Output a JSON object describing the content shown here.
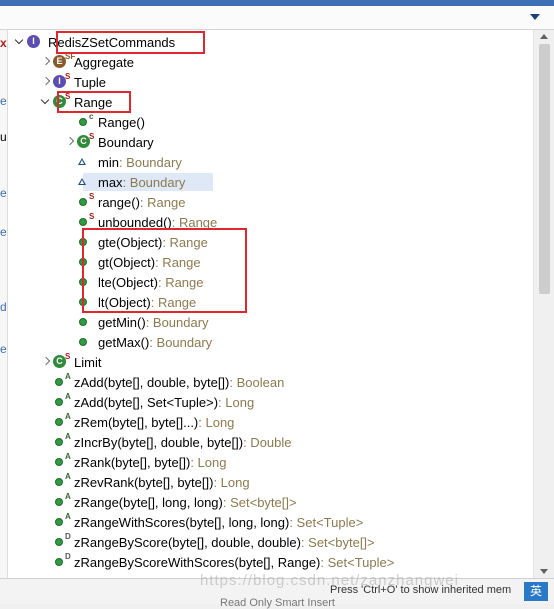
{
  "outline": {
    "root": {
      "label": "RedisZSetCommands",
      "icon": "interface-icon"
    },
    "items": [
      {
        "label": "Aggregate",
        "type": "",
        "indent": 1,
        "exp": "collapsed",
        "icon": "enum",
        "letter": "E",
        "mod": "SF",
        "modclass": "f"
      },
      {
        "label": "Tuple",
        "type": "",
        "indent": 1,
        "exp": "collapsed",
        "icon": "intf",
        "letter": "I",
        "mod": "S",
        "modclass": "s"
      },
      {
        "label": "Range",
        "type": "",
        "indent": 1,
        "exp": "expanded",
        "icon": "cls",
        "letter": "C",
        "mod": "S",
        "modclass": "s"
      },
      {
        "label": "Range()",
        "type": "",
        "indent": 2,
        "exp": "none",
        "icon": "dot",
        "mod": "c",
        "modclass": "c"
      },
      {
        "label": "Boundary",
        "type": "",
        "indent": 2,
        "exp": "collapsed",
        "icon": "cls",
        "letter": "C",
        "mod": "S",
        "modclass": "s"
      },
      {
        "label": "min",
        "type": " : Boundary",
        "indent": 2,
        "exp": "none",
        "icon": "tri",
        "mod": "",
        "modclass": ""
      },
      {
        "label": "max",
        "type": " : Boundary",
        "indent": 2,
        "exp": "none",
        "icon": "tri",
        "mod": "",
        "modclass": "",
        "selected": true
      },
      {
        "label": "range()",
        "type": " : Range",
        "indent": 2,
        "exp": "none",
        "icon": "dot",
        "mod": "S",
        "modclass": "s"
      },
      {
        "label": "unbounded()",
        "type": " : Range",
        "indent": 2,
        "exp": "none",
        "icon": "dot",
        "mod": "S",
        "modclass": "s"
      },
      {
        "label": "gte(Object)",
        "type": " : Range",
        "indent": 2,
        "exp": "none",
        "icon": "dot",
        "mod": "",
        "modclass": ""
      },
      {
        "label": "gt(Object)",
        "type": " : Range",
        "indent": 2,
        "exp": "none",
        "icon": "dot",
        "mod": "",
        "modclass": ""
      },
      {
        "label": "lte(Object)",
        "type": " : Range",
        "indent": 2,
        "exp": "none",
        "icon": "dot",
        "mod": "",
        "modclass": ""
      },
      {
        "label": "lt(Object)",
        "type": " : Range",
        "indent": 2,
        "exp": "none",
        "icon": "dot",
        "mod": "",
        "modclass": ""
      },
      {
        "label": "getMin()",
        "type": " : Boundary",
        "indent": 2,
        "exp": "none",
        "icon": "dot",
        "mod": "",
        "modclass": ""
      },
      {
        "label": "getMax()",
        "type": " : Boundary",
        "indent": 2,
        "exp": "none",
        "icon": "dot",
        "mod": "",
        "modclass": ""
      },
      {
        "label": "Limit",
        "type": "",
        "indent": 1,
        "exp": "collapsed",
        "icon": "cls",
        "letter": "C",
        "mod": "S",
        "modclass": "s"
      },
      {
        "label": "zAdd(byte[], double, byte[])",
        "type": " : Boolean",
        "indent": 1,
        "exp": "none",
        "icon": "dot",
        "mod": "A",
        "modclass": "a"
      },
      {
        "label": "zAdd(byte[], Set<Tuple>)",
        "type": " : Long",
        "indent": 1,
        "exp": "none",
        "icon": "dot",
        "mod": "A",
        "modclass": "a"
      },
      {
        "label": "zRem(byte[], byte[]...)",
        "type": " : Long",
        "indent": 1,
        "exp": "none",
        "icon": "dot",
        "mod": "A",
        "modclass": "a"
      },
      {
        "label": "zIncrBy(byte[], double, byte[])",
        "type": " : Double",
        "indent": 1,
        "exp": "none",
        "icon": "dot",
        "mod": "A",
        "modclass": "a"
      },
      {
        "label": "zRank(byte[], byte[])",
        "type": " : Long",
        "indent": 1,
        "exp": "none",
        "icon": "dot",
        "mod": "A",
        "modclass": "a"
      },
      {
        "label": "zRevRank(byte[], byte[])",
        "type": " : Long",
        "indent": 1,
        "exp": "none",
        "icon": "dot",
        "mod": "A",
        "modclass": "a"
      },
      {
        "label": "zRange(byte[], long, long)",
        "type": " : Set<byte[]>",
        "indent": 1,
        "exp": "none",
        "icon": "dot",
        "mod": "A",
        "modclass": "a"
      },
      {
        "label": "zRangeWithScores(byte[], long, long)",
        "type": " : Set<Tuple>",
        "indent": 1,
        "exp": "none",
        "icon": "dot",
        "mod": "A",
        "modclass": "a"
      },
      {
        "label": "zRangeByScore(byte[], double, double)",
        "type": " : Set<byte[]>",
        "indent": 1,
        "exp": "none",
        "icon": "dot",
        "mod": "D",
        "modclass": "d"
      },
      {
        "label": "zRangeByScoreWithScores(byte[], Range)",
        "type": " : Set<Tuple>",
        "indent": 1,
        "exp": "none",
        "icon": "dot",
        "mod": "D",
        "modclass": "d"
      }
    ]
  },
  "footer": {
    "hint": "Press 'Ctrl+O' to show inherited mem",
    "watermark": "https://blog.csdn.net/zanzhangwei",
    "ime": "英",
    "under": "Read Only   Smart Insert"
  },
  "left_edge": [
    "x",
    "e",
    "u",
    "e",
    "e",
    "d",
    "e"
  ]
}
